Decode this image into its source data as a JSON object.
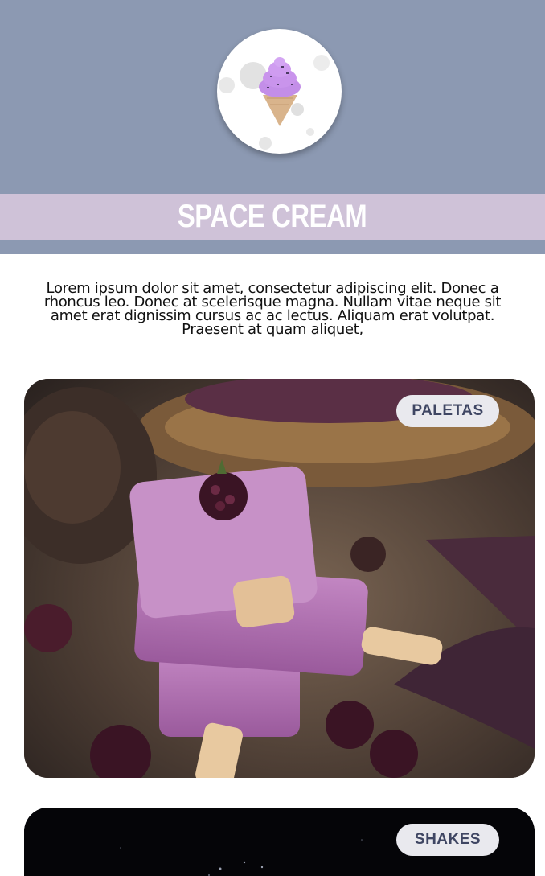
{
  "header": {
    "logo_icon": "ice-cream-cone-icon",
    "background_color": "#8c99b2",
    "band_color": "#cfc2d8"
  },
  "site": {
    "title": "SPACE CREAM",
    "intro": "Lorem ipsum dolor sit amet, consectetur adipiscing elit. Donec a rhoncus leo. Donec at scelerisque magna. Nullam vitae neque sit amet erat dignissim cursus ac ac lectus. Aliquam erat volutpat. Praesent at quam aliquet,"
  },
  "cards": [
    {
      "label": "PALETAS",
      "image": "paletas-photo"
    },
    {
      "label": "SHAKES",
      "image": "space-photo"
    }
  ],
  "colors": {
    "pill_text": "#3f4663",
    "pill_bg": "#e9e9ee"
  }
}
